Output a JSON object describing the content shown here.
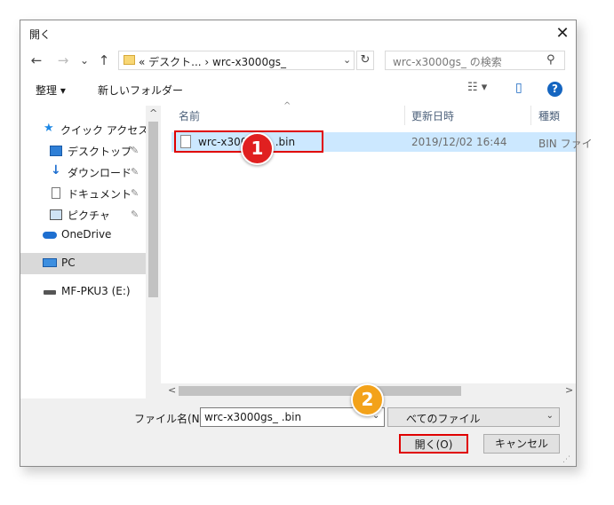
{
  "window": {
    "title": "開く",
    "close_glyph": "✕"
  },
  "nav": {
    "back": "←",
    "forward": "→",
    "recent": "⌄",
    "up": "↑"
  },
  "address": {
    "path": "« デスクト...  ›  wrc-x3000gs_",
    "dropdown": "⌄",
    "refresh": "↻"
  },
  "search": {
    "placeholder": "wrc-x3000gs_       の検索",
    "icon": "⚲"
  },
  "toolbar": {
    "organize": "整理 ▾",
    "new_folder": "新しいフォルダー",
    "view": "☷ ▾",
    "pane": "▯",
    "help": "?"
  },
  "navpane": {
    "items": [
      {
        "label": "クイック アクセス"
      },
      {
        "label": "デスクトップ"
      },
      {
        "label": "ダウンロード"
      },
      {
        "label": "ドキュメント"
      },
      {
        "label": "ピクチャ"
      },
      {
        "label": "OneDrive"
      },
      {
        "label": "PC"
      },
      {
        "label": "MF-PKU3 (E:)"
      }
    ],
    "pin": "📌"
  },
  "columns": {
    "name": "名前",
    "modified": "更新日時",
    "type": "種類",
    "sort": "^"
  },
  "files": [
    {
      "name": "wrc-x3000gs_          .bin",
      "modified": "2019/12/02 16:44",
      "type": "BIN ファイ"
    }
  ],
  "scroll": {
    "up": "^",
    "down": "⌄",
    "left": "<",
    "right": ">"
  },
  "footer": {
    "filename_label": "ファイル名(N):",
    "filename_value": "wrc-x3000gs_          .bin",
    "filetype": "べてのファイル",
    "dropdown": "⌄",
    "open": "開く(O)",
    "cancel": "キャンセル"
  },
  "annotations": {
    "step1": "1",
    "step2": "2"
  }
}
